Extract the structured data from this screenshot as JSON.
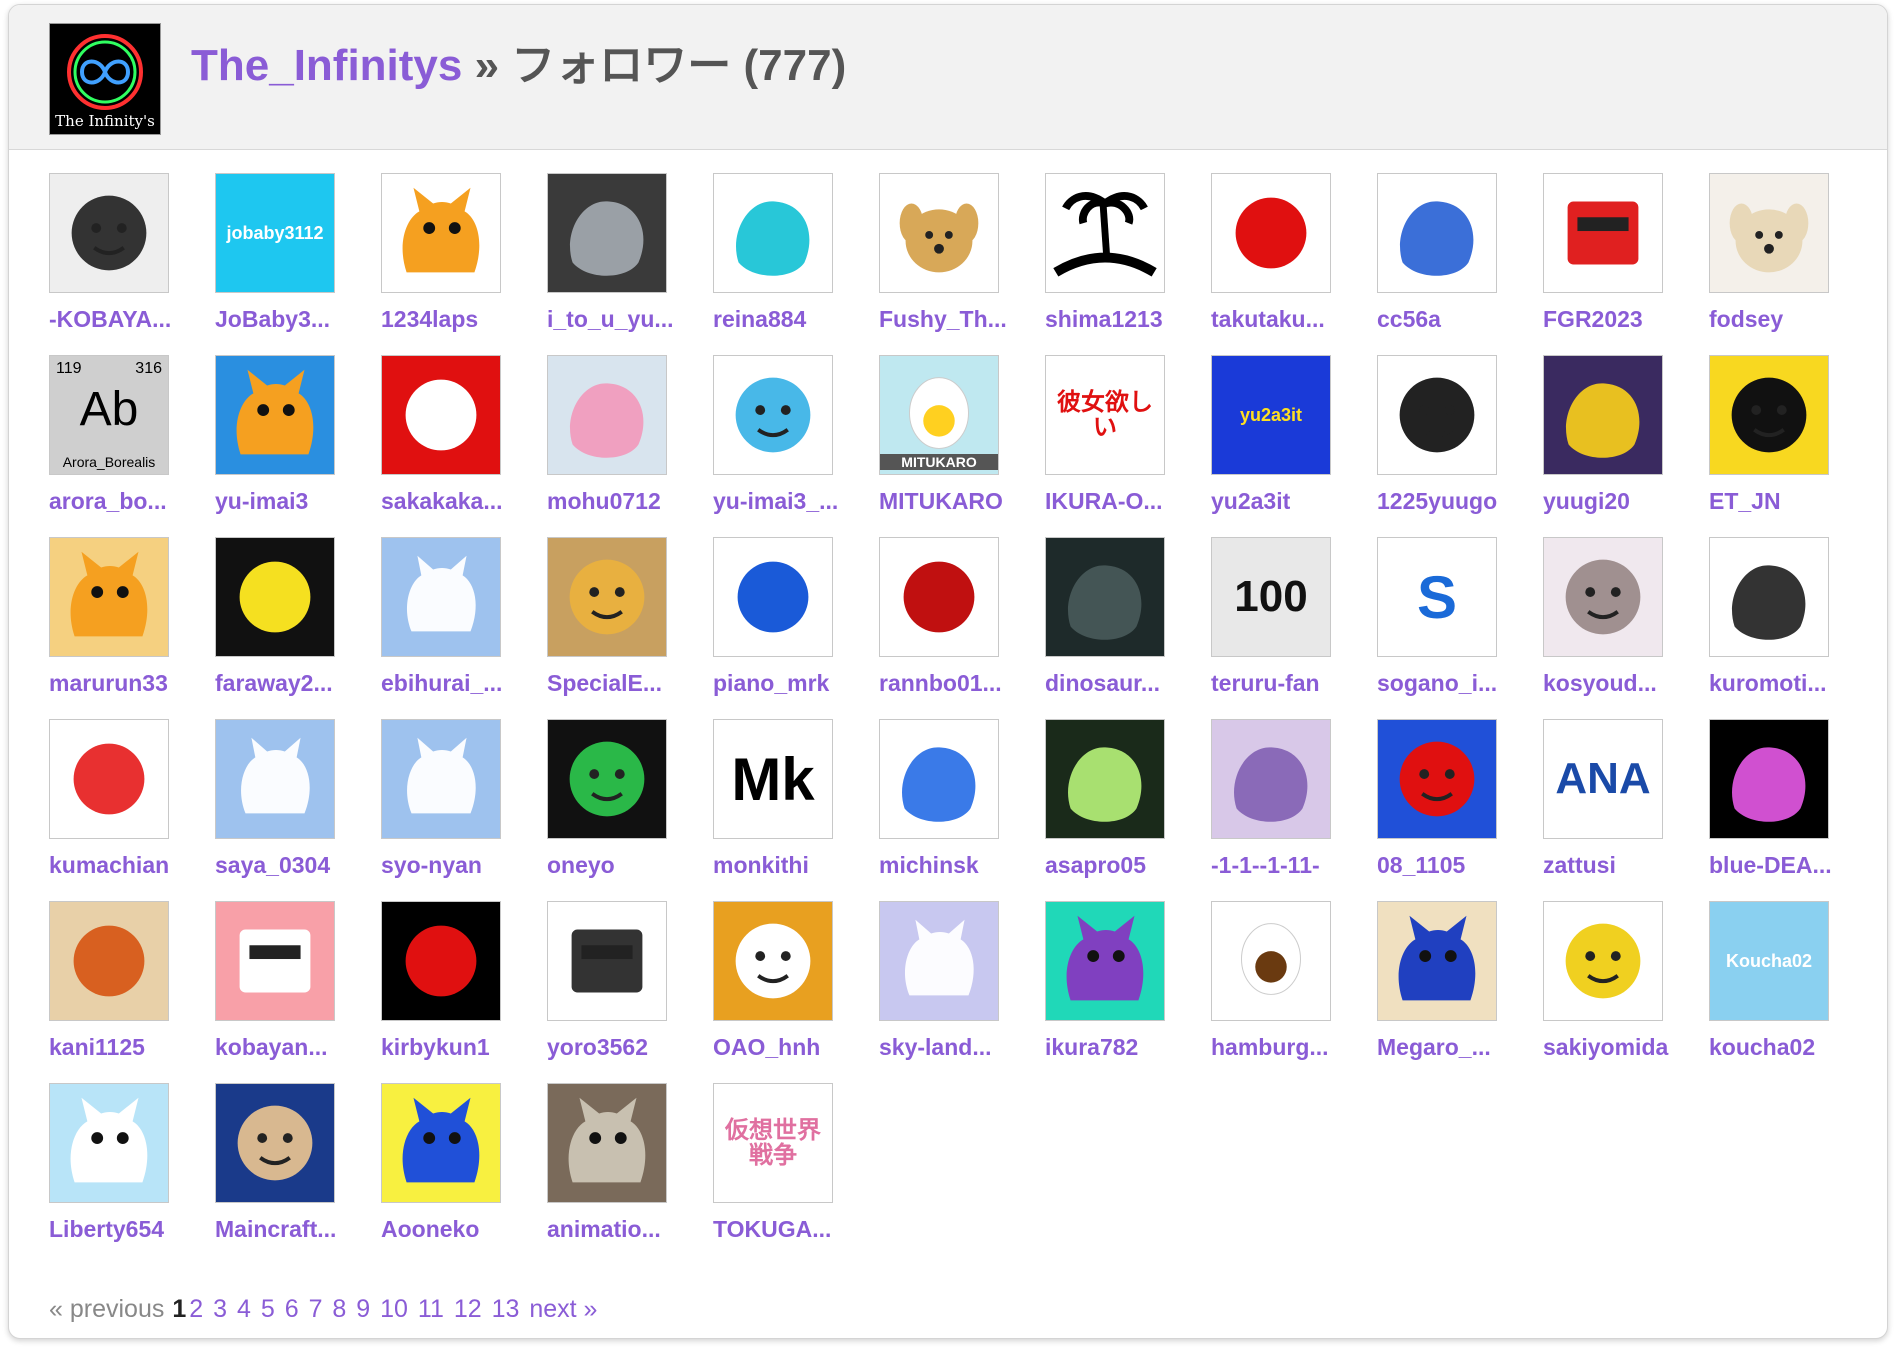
{
  "header": {
    "username": "The_Infinitys",
    "separator": " » ",
    "section": "フォロワー (777)",
    "logo_caption": "The Infinity's"
  },
  "followers": [
    {
      "name": "-KOBAYA...",
      "bg": "#eeeeee",
      "art": "face",
      "fg": "#333333"
    },
    {
      "name": "JoBaby3...",
      "bg": "#1ec7f0",
      "art": "text",
      "fg": "#ffffff",
      "label": "jobaby3112"
    },
    {
      "name": "1234laps",
      "bg": "#ffffff",
      "art": "cat",
      "fg": "#f5a020"
    },
    {
      "name": "i_to_u_yu...",
      "bg": "#3a3a3a",
      "art": "blob",
      "fg": "#9aa0a6"
    },
    {
      "name": "reina884",
      "bg": "#ffffff",
      "art": "blob",
      "fg": "#28c7d8"
    },
    {
      "name": "Fushy_Th...",
      "bg": "#ffffff",
      "art": "dog",
      "fg": "#d8a858"
    },
    {
      "name": "shima1213",
      "bg": "#ffffff",
      "art": "palm",
      "fg": "#000000"
    },
    {
      "name": "takutaku...",
      "bg": "#ffffff",
      "art": "sun",
      "fg": "#e01010"
    },
    {
      "name": "cc56a",
      "bg": "#ffffff",
      "art": "blob",
      "fg": "#3b6fd8"
    },
    {
      "name": "FGR2023",
      "bg": "#ffffff",
      "art": "block",
      "fg": "#e02020"
    },
    {
      "name": "fodsey",
      "bg": "#f4f0ea",
      "art": "dog",
      "fg": "#e8d8b8"
    },
    {
      "name": "arora_bo...",
      "bg": "#cfcfcf",
      "art": "element",
      "fg": "#000000",
      "label": "Ab",
      "num_left": "119",
      "num_right": "316",
      "sub": "Arora_Borealis"
    },
    {
      "name": "yu-imai3",
      "bg": "#2a8fe0",
      "art": "cat",
      "fg": "#f5a020"
    },
    {
      "name": "sakakaka...",
      "bg": "#e01010",
      "art": "sun",
      "fg": "#ffffff"
    },
    {
      "name": "mohu0712",
      "bg": "#d8e4ee",
      "art": "blob",
      "fg": "#f0a0c0"
    },
    {
      "name": "yu-imai3_...",
      "bg": "#ffffff",
      "art": "face",
      "fg": "#48b8e8"
    },
    {
      "name": "MITUKARO",
      "bg": "#bfe8f0",
      "art": "egg",
      "fg": "#ffd020",
      "label": "MITUKARO"
    },
    {
      "name": "IKURA-O...",
      "bg": "#ffffff",
      "art": "text",
      "fg": "#e01010",
      "label": "彼女欲しい"
    },
    {
      "name": "yu2a3it",
      "bg": "#1a3ad8",
      "art": "text",
      "fg": "#ffe020",
      "label": "yu2a3it"
    },
    {
      "name": "1225yuugo",
      "bg": "#ffffff",
      "art": "face",
      "fg": "#222222"
    },
    {
      "name": "yuugi20",
      "bg": "#3a2a60",
      "art": "blob",
      "fg": "#e8c020"
    },
    {
      "name": "ET_JN",
      "bg": "#f8d820",
      "art": "face",
      "fg": "#111111"
    },
    {
      "name": "marurun33",
      "bg": "#f5d080",
      "art": "cat",
      "fg": "#f5a020"
    },
    {
      "name": "faraway2...",
      "bg": "#111111",
      "art": "sun",
      "fg": "#f5e020"
    },
    {
      "name": "ebihurai_...",
      "bg": "#9ec2ee",
      "art": "default",
      "fg": "#ffffff"
    },
    {
      "name": "SpecialE...",
      "bg": "#c8a060",
      "art": "face",
      "fg": "#e8b040"
    },
    {
      "name": "piano_mrk",
      "bg": "#ffffff",
      "art": "sun",
      "fg": "#1a5ad8"
    },
    {
      "name": "rannbo01...",
      "bg": "#ffffff",
      "art": "sun",
      "fg": "#c01010"
    },
    {
      "name": "dinosaur...",
      "bg": "#1e2a2a",
      "art": "blob",
      "fg": "#445555"
    },
    {
      "name": "teruru-fan",
      "bg": "#e8e8e8",
      "art": "text",
      "fg": "#111111",
      "label": "100"
    },
    {
      "name": "sogano_i...",
      "bg": "#ffffff",
      "art": "text",
      "fg": "#1a6ad8",
      "label": "S"
    },
    {
      "name": "kosyoud...",
      "bg": "#f0e8ee",
      "art": "face",
      "fg": "#a09090"
    },
    {
      "name": "kuromoti...",
      "bg": "#ffffff",
      "art": "blob",
      "fg": "#333333"
    },
    {
      "name": "kumachian",
      "bg": "#ffffff",
      "art": "sun",
      "fg": "#e83030"
    },
    {
      "name": "saya_0304",
      "bg": "#9ec2ee",
      "art": "default",
      "fg": "#ffffff"
    },
    {
      "name": "syo-nyan",
      "bg": "#9ec2ee",
      "art": "default",
      "fg": "#ffffff"
    },
    {
      "name": "oneyo",
      "bg": "#111111",
      "art": "face",
      "fg": "#2ab848"
    },
    {
      "name": "monkithi",
      "bg": "#ffffff",
      "art": "text",
      "fg": "#000000",
      "label": "Mk"
    },
    {
      "name": "michinsk",
      "bg": "#ffffff",
      "art": "blob",
      "fg": "#3a7ae8"
    },
    {
      "name": "asapro05",
      "bg": "#1a2a1a",
      "art": "blob",
      "fg": "#a8e070"
    },
    {
      "name": "-1-1--1-11-",
      "bg": "#d8c8e8",
      "art": "blob",
      "fg": "#8a6ab8"
    },
    {
      "name": "08_1105",
      "bg": "#2050d8",
      "art": "face",
      "fg": "#e01010"
    },
    {
      "name": "zattusi",
      "bg": "#ffffff",
      "art": "text",
      "fg": "#1a4aa8",
      "label": "ANA"
    },
    {
      "name": "blue-DEA...",
      "bg": "#000000",
      "art": "blob",
      "fg": "#d050d0"
    },
    {
      "name": "kani1125",
      "bg": "#e8d0a8",
      "art": "sun",
      "fg": "#d86020"
    },
    {
      "name": "kobayan...",
      "bg": "#f8a0a8",
      "art": "block",
      "fg": "#ffffff"
    },
    {
      "name": "kirbykun1",
      "bg": "#000000",
      "art": "sun",
      "fg": "#e01010"
    },
    {
      "name": "yoro3562",
      "bg": "#ffffff",
      "art": "block",
      "fg": "#333333"
    },
    {
      "name": "OAO_hnh",
      "bg": "#e8a020",
      "art": "face",
      "fg": "#ffffff"
    },
    {
      "name": "sky-land...",
      "bg": "#c8c8f0",
      "art": "default",
      "fg": "#ffffff"
    },
    {
      "name": "ikura782",
      "bg": "#20d8b8",
      "art": "cat",
      "fg": "#8040c0"
    },
    {
      "name": "hamburg...",
      "bg": "#ffffff",
      "art": "egg",
      "fg": "#6a3a10"
    },
    {
      "name": "Megaro_...",
      "bg": "#f0e0c0",
      "art": "cat",
      "fg": "#2040c0"
    },
    {
      "name": "sakiyomida",
      "bg": "#ffffff",
      "art": "face",
      "fg": "#f0d020"
    },
    {
      "name": "koucha02",
      "bg": "#8ad0f0",
      "art": "text",
      "fg": "#ffffff",
      "label": "Koucha02"
    },
    {
      "name": "Liberty654",
      "bg": "#b8e4f8",
      "art": "cat",
      "fg": "#ffffff"
    },
    {
      "name": "Maincraft...",
      "bg": "#1a3a8a",
      "art": "face",
      "fg": "#d8b890"
    },
    {
      "name": "Aooneko",
      "bg": "#f8f040",
      "art": "cat",
      "fg": "#2050d8"
    },
    {
      "name": "animatio...",
      "bg": "#7a6a5a",
      "art": "cat",
      "fg": "#c8c0b0"
    },
    {
      "name": "TOKUGA...",
      "bg": "#ffffff",
      "art": "text",
      "fg": "#e070a0",
      "label": "仮想世界戦争"
    }
  ],
  "pagination": {
    "previous": "« previous",
    "current": "1",
    "pages": [
      "2",
      "3",
      "4",
      "5",
      "6",
      "7",
      "8",
      "9",
      "10",
      "11",
      "12",
      "13"
    ],
    "next": "next »"
  }
}
